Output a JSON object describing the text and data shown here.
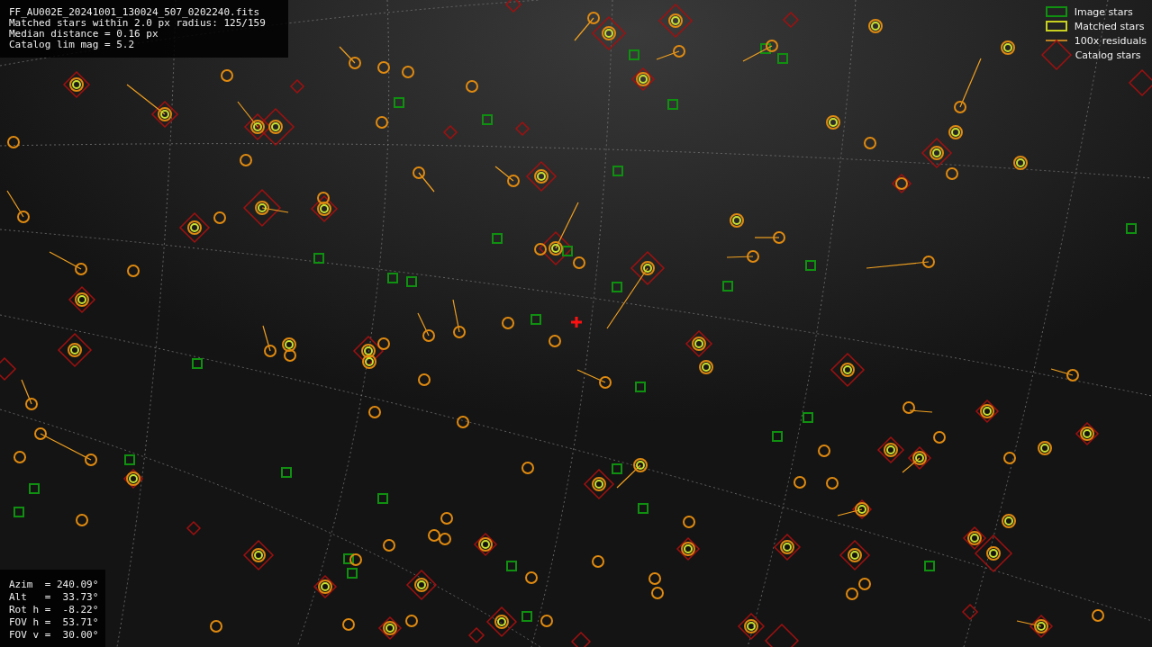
{
  "info_lines": [
    "FF_AU002E_20241001_130024_507_0202240.fits",
    "Matched stars within 2.0 px radius: 125/159",
    "Median distance = 0.16 px",
    "Catalog lim mag = 5.2"
  ],
  "legend": [
    {
      "kind": "image",
      "label": "Image stars"
    },
    {
      "kind": "matched",
      "label": "Matched stars"
    },
    {
      "kind": "residual",
      "label": "100x residuals"
    },
    {
      "kind": "catalog",
      "label": "Catalog stars"
    }
  ],
  "pointing_lines": [
    "Azim  = 240.09°",
    "Alt   =  33.73°",
    "Rot h =  -8.22°",
    "FOV h =  53.71°",
    "FOV v =  30.00°"
  ]
}
